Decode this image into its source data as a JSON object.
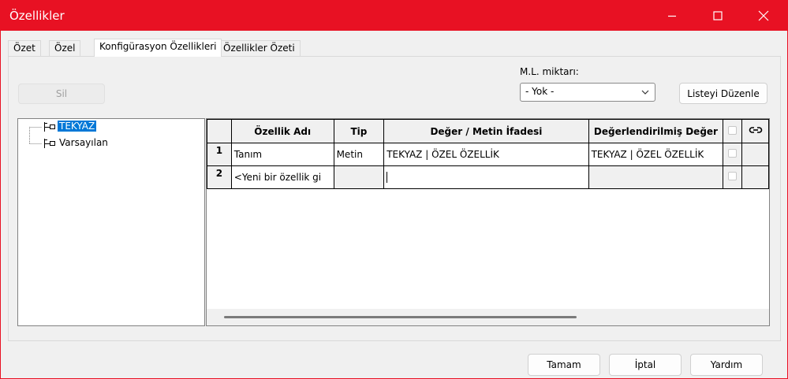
{
  "window": {
    "title": "Özellikler"
  },
  "tabs": [
    {
      "label": "Özet"
    },
    {
      "label": "Özel"
    },
    {
      "label": "Konfigürasyon Özellikleri"
    },
    {
      "label": "Özellikler Özeti"
    }
  ],
  "toolbar": {
    "delete_label": "Sil",
    "ml_label": "M.L. miktarı:",
    "ml_value": "- Yok -",
    "edit_list_label": "Listeyi Düzenle"
  },
  "tree": {
    "items": [
      {
        "label": "TEKYAZ",
        "selected": true
      },
      {
        "label": "Varsayılan",
        "selected": false
      }
    ]
  },
  "grid": {
    "headers": [
      "Özellik Adı",
      "Tip",
      "Değer / Metin İfadesi",
      "Değerlendirilmiş Değer"
    ],
    "rows": [
      {
        "num": "1",
        "name": "Tanım",
        "type": "Metin",
        "value": "TEKYAZ | ÖZEL ÖZELLİK",
        "evaluated": "TEKYAZ | ÖZEL ÖZELLİK"
      },
      {
        "num": "2",
        "name": "<Yeni bir özellik gi",
        "type": "",
        "value": "",
        "evaluated": ""
      }
    ]
  },
  "footer": {
    "ok_label": "Tamam",
    "cancel_label": "İptal",
    "help_label": "Yardım"
  },
  "colors": {
    "titlebar": "#e81123",
    "selection": "#0078d7"
  }
}
